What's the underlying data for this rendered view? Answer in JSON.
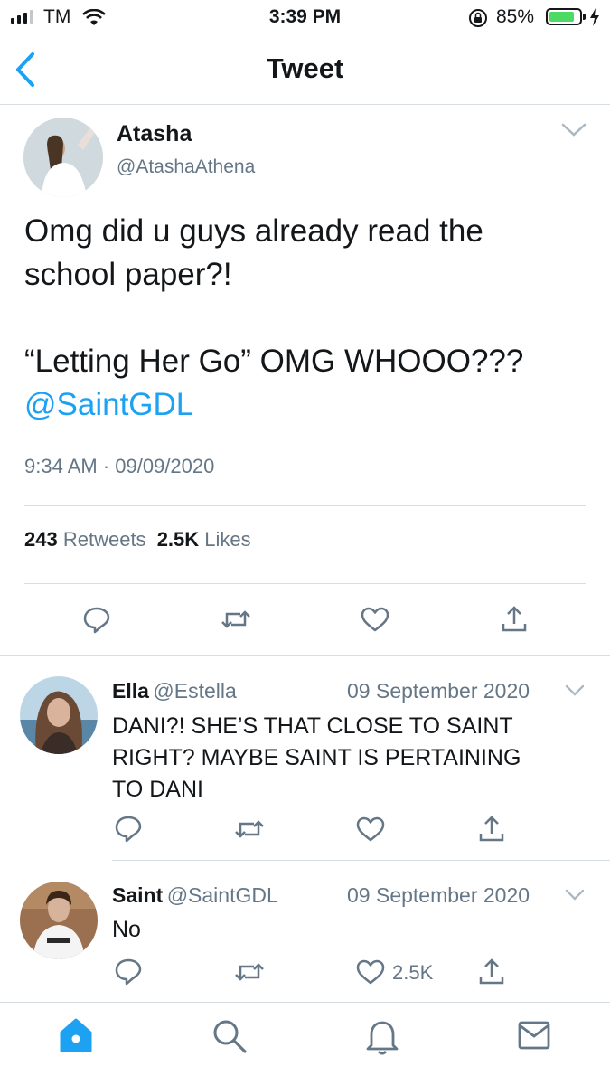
{
  "status_bar": {
    "carrier": "TM",
    "time": "3:39 PM",
    "battery": "85%",
    "battery_level": 0.85
  },
  "nav": {
    "title": "Tweet",
    "back_icon": "chevron-left-icon"
  },
  "tweet": {
    "name": "Atasha",
    "handle": "@AtashaAthena",
    "text_line1": "Omg did u guys already read the",
    "text_line2": "school paper?!",
    "text_line3": "“Letting Her Go” OMG WHOOO???",
    "mention": "@SaintGDL",
    "timestamp": "9:34 AM · 09/09/2020",
    "retweets_count": "243",
    "retweets_label": "Retweets",
    "likes_count": "2.5K",
    "likes_label": "Likes"
  },
  "replies": [
    {
      "name": "Ella",
      "handle": "@Estella",
      "date": "09 September 2020",
      "text_lines": [
        "DANI?! SHE’S THAT CLOSE TO SAINT",
        "RIGHT? MAYBE SAINT IS PERTAINING",
        "TO DANI"
      ],
      "likes": ""
    },
    {
      "name": "Saint",
      "handle": "@SaintGDL",
      "date": "09 September 2020",
      "text_lines": [
        "No"
      ],
      "likes": "2.5K"
    }
  ],
  "tab_bar": {
    "items": [
      "home-icon",
      "search-icon",
      "bell-icon",
      "mail-icon"
    ]
  },
  "colors": {
    "accent": "#1da1f2",
    "secondary_text": "#657786",
    "battery_green": "#4cd964"
  }
}
